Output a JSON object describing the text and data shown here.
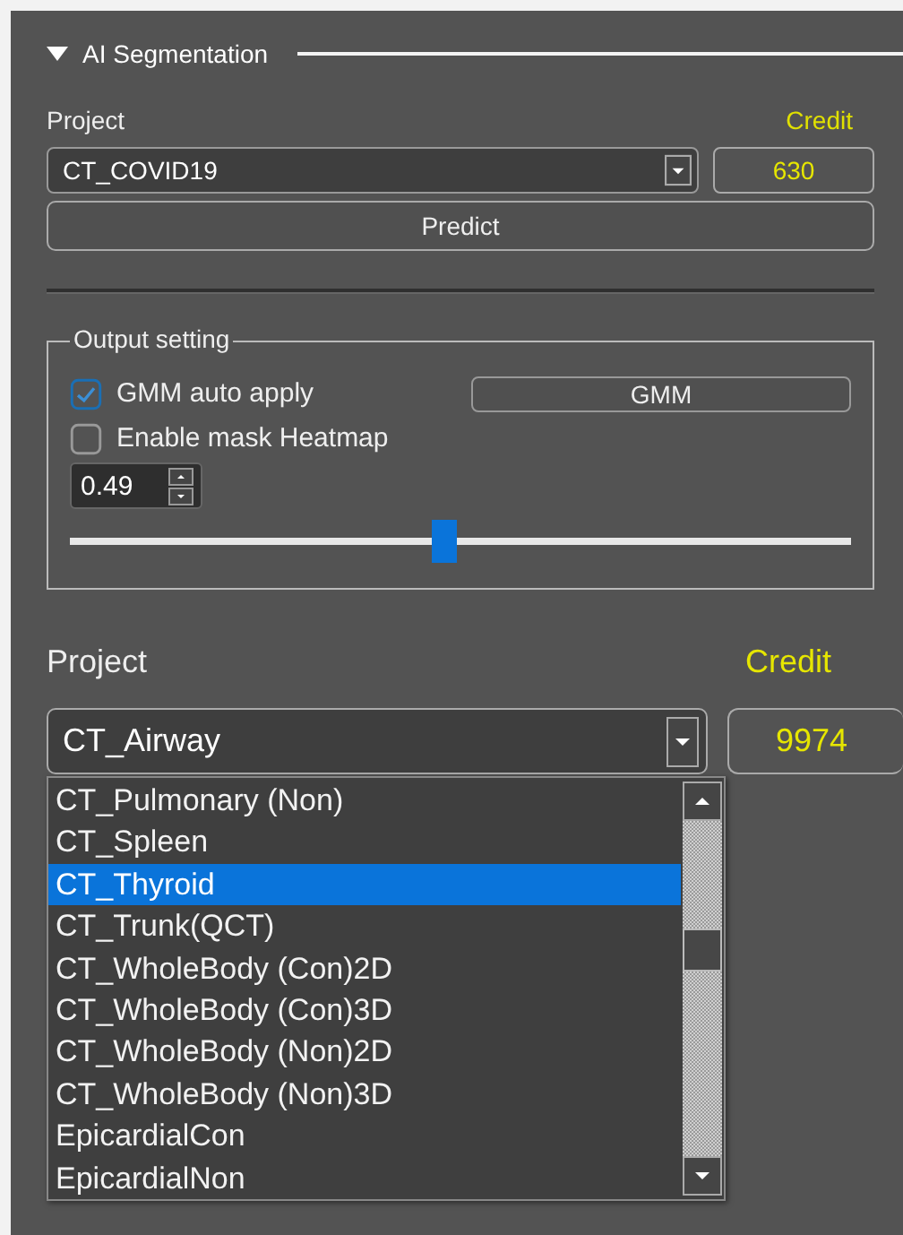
{
  "section": {
    "title": "AI Segmentation",
    "expanded": true
  },
  "top": {
    "project_label": "Project",
    "credit_label": "Credit",
    "project_value": "CT_COVID19",
    "credit_value": "630",
    "predict_button": "Predict"
  },
  "output_setting": {
    "title": "Output setting",
    "options": [
      {
        "label": "GMM auto apply",
        "checked": true
      },
      {
        "label": "Enable mask Heatmap",
        "checked": false
      }
    ],
    "gmm_button": "GMM",
    "threshold": "0.49",
    "slider": {
      "level": 0.48
    }
  },
  "bottom": {
    "project_label": "Project",
    "credit_label": "Credit",
    "project_value": "CT_Airway",
    "credit_value": "9974",
    "dropdown": {
      "open": true,
      "items": [
        {
          "label": "CT_Pulmonary (Non)",
          "selected": false
        },
        {
          "label": "CT_Spleen",
          "selected": false
        },
        {
          "label": "CT_Thyroid",
          "selected": true
        },
        {
          "label": "CT_Trunk(QCT)",
          "selected": false
        },
        {
          "label": "CT_WholeBody (Con)2D",
          "selected": false
        },
        {
          "label": "CT_WholeBody (Con)3D",
          "selected": false
        },
        {
          "label": "CT_WholeBody (Non)2D",
          "selected": false
        },
        {
          "label": "CT_WholeBody (Non)3D",
          "selected": false
        },
        {
          "label": "EpicardialCon",
          "selected": false
        },
        {
          "label": "EpicardialNon",
          "selected": false
        }
      ]
    }
  }
}
